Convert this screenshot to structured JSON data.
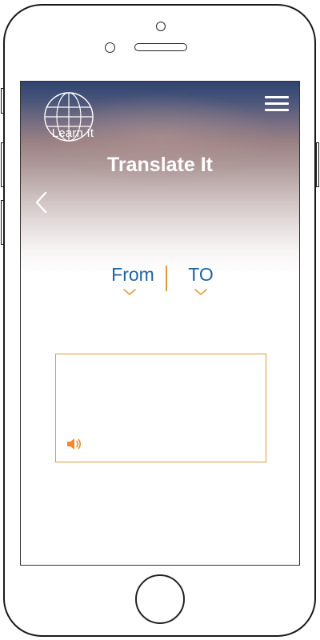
{
  "app": {
    "logo_text": "Learn It",
    "title": "Translate It"
  },
  "icons": {
    "logo": "globe-icon",
    "menu": "hamburger-menu-icon",
    "back": "chevron-left-icon",
    "dropdown": "chevron-down-icon",
    "audio": "speaker-icon"
  },
  "language_selector": {
    "from_label": "From",
    "to_label": "TO"
  },
  "translation": {
    "output_text": ""
  },
  "colors": {
    "accent_orange": "#e29a3c",
    "label_blue": "#1f63a6",
    "speaker_orange": "#f08a24",
    "header_top": "#2e4470"
  }
}
